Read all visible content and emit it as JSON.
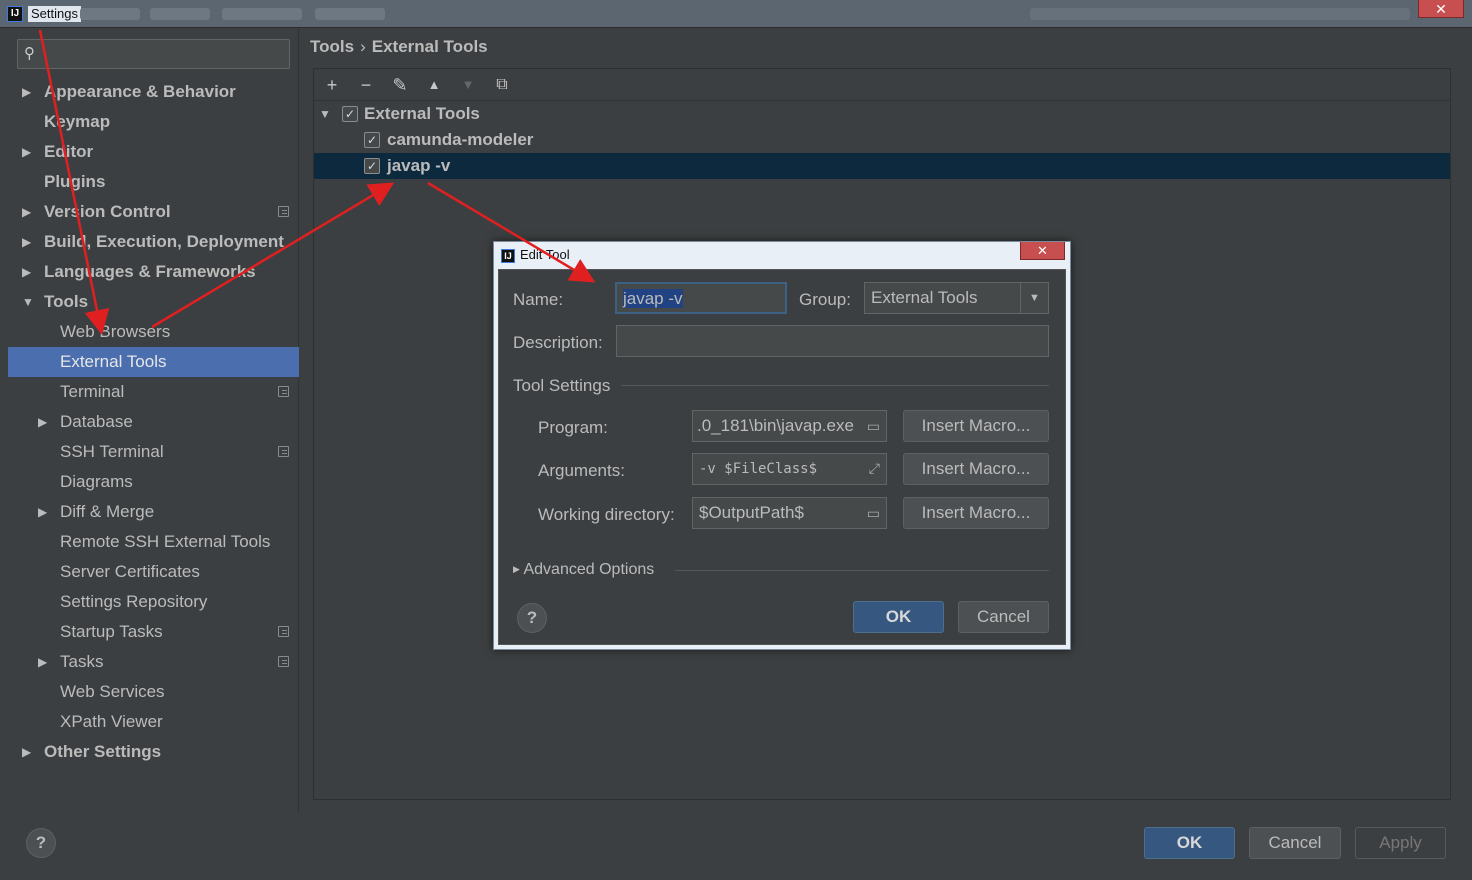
{
  "window": {
    "title": "Settings",
    "close_glyph": "✕"
  },
  "search": {
    "icon": "search-icon",
    "placeholder": ""
  },
  "sidebar": {
    "items": [
      {
        "label": "Appearance & Behavior"
      },
      {
        "label": "Keymap"
      },
      {
        "label": "Editor"
      },
      {
        "label": "Plugins"
      },
      {
        "label": "Version Control"
      },
      {
        "label": "Build, Execution, Deployment"
      },
      {
        "label": "Languages & Frameworks"
      },
      {
        "label": "Tools"
      },
      {
        "label": "Web Browsers"
      },
      {
        "label": "External Tools"
      },
      {
        "label": "Terminal"
      },
      {
        "label": "Database"
      },
      {
        "label": "SSH Terminal"
      },
      {
        "label": "Diagrams"
      },
      {
        "label": "Diff & Merge"
      },
      {
        "label": "Remote SSH External Tools"
      },
      {
        "label": "Server Certificates"
      },
      {
        "label": "Settings Repository"
      },
      {
        "label": "Startup Tasks"
      },
      {
        "label": "Tasks"
      },
      {
        "label": "Web Services"
      },
      {
        "label": "XPath Viewer"
      },
      {
        "label": "Other Settings"
      }
    ]
  },
  "breadcrumb": {
    "parent": "Tools",
    "separator": "›",
    "current": "External Tools"
  },
  "toolbar": {
    "add": "+",
    "remove": "−",
    "edit": "✎",
    "up": "▲",
    "down": "▼",
    "copy": "⧉"
  },
  "tools_tree": {
    "group": {
      "label": "External Tools",
      "checked": true
    },
    "items": [
      {
        "label": "camunda-modeler",
        "checked": true
      },
      {
        "label": "javap -v",
        "checked": true
      }
    ]
  },
  "edit_tool": {
    "title": "Edit Tool",
    "name_label": "Name:",
    "name_value": "javap -v",
    "group_label": "Group:",
    "group_value": "External Tools",
    "description_label": "Description:",
    "description_value": "",
    "tool_settings_title": "Tool Settings",
    "program_label": "Program:",
    "program_value": ".0_181\\bin\\javap.exe",
    "arguments_label": "Arguments:",
    "arguments_value": "-v $FileClass$",
    "workdir_label": "Working directory:",
    "workdir_value": "$OutputPath$",
    "insert_macro": "Insert Macro...",
    "advanced_options": "Advanced Options",
    "ok": "OK",
    "cancel": "Cancel",
    "help": "?"
  },
  "footer": {
    "ok": "OK",
    "cancel": "Cancel",
    "apply": "Apply",
    "help": "?"
  },
  "colors": {
    "selection": "#4b6eaf",
    "tree_selection": "#0d293e",
    "annotation_arrow": "#e02020",
    "primary_button": "#365880"
  }
}
